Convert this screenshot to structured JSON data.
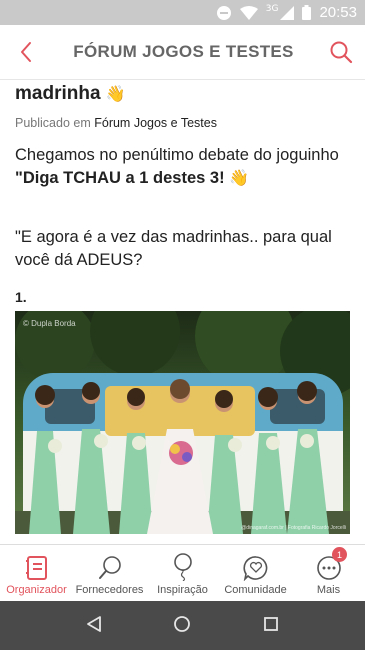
{
  "status_bar": {
    "time": "20:53",
    "network": "3G"
  },
  "header": {
    "title": "FÓRUM JOGOS E TESTES"
  },
  "post": {
    "title_tail": "madrinha",
    "title_emoji": "👋",
    "meta_prefix": "Publicado em",
    "meta_category": "Fórum Jogos e Testes",
    "paragraph1_line1": "Chegamos no penúltimo debate do joguinho",
    "paragraph1_quote": "\"",
    "paragraph1_bold": "Diga TCHAU a 1 destes 3",
    "paragraph1_end": "!",
    "paragraph1_emoji": "👋",
    "paragraph2": "\"E agora é a vez das madrinhas.. para qual você dá ADEUS?",
    "item_number": "1.",
    "photo_watermark": "© Dupla Borda",
    "photo_credit": "@dinagaraf.com.br | Fotografia Ricardo Jorcelli"
  },
  "tabs": [
    {
      "label": "Organizador",
      "icon": "organizer-book-icon",
      "active": true
    },
    {
      "label": "Fornecedores",
      "icon": "magnifier-icon",
      "active": false
    },
    {
      "label": "Inspiração",
      "icon": "balloon-icon",
      "active": false
    },
    {
      "label": "Comunidade",
      "icon": "heart-chat-icon",
      "active": false
    },
    {
      "label": "Mais",
      "icon": "more-dots-icon",
      "active": false,
      "badge": "1"
    }
  ],
  "colors": {
    "accent": "#e2545d",
    "header_text": "#666666",
    "status_bar": "#c9c9c9",
    "nav_bar": "#4a4a4a"
  }
}
